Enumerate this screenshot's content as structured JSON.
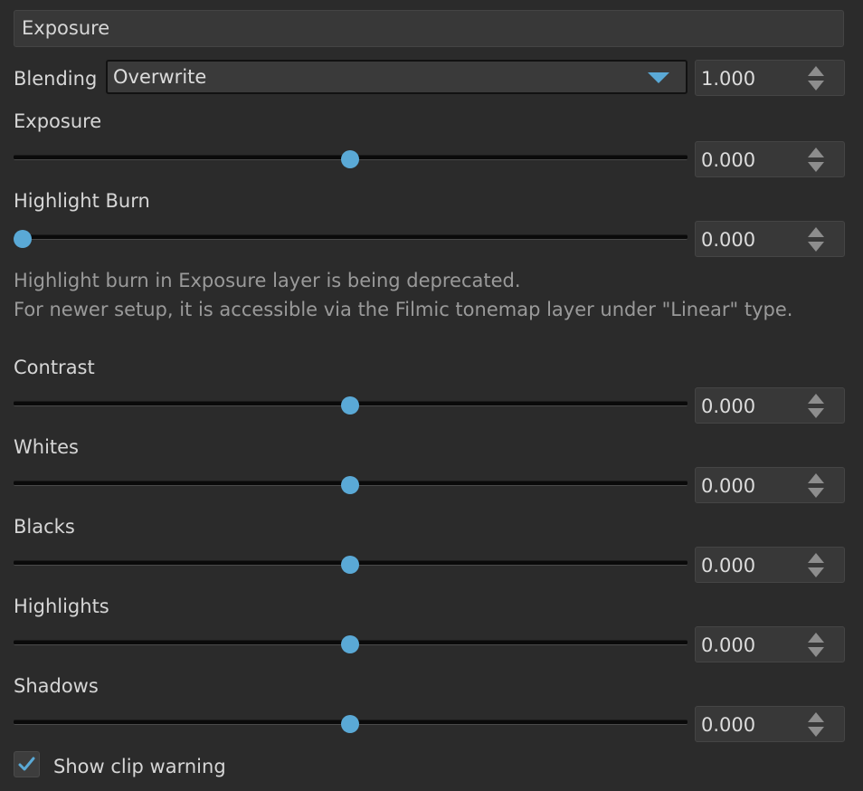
{
  "layer": {
    "name": "Exposure"
  },
  "blending": {
    "label": "Blending",
    "mode": "Overwrite",
    "opacity": "1.000"
  },
  "sliders": [
    {
      "label": "Exposure",
      "value": "0.000",
      "position": 0.5
    },
    {
      "label": "Highlight Burn",
      "value": "0.000",
      "position": 0.0
    },
    {
      "label": "Contrast",
      "value": "0.000",
      "position": 0.5
    },
    {
      "label": "Whites",
      "value": "0.000",
      "position": 0.5
    },
    {
      "label": "Blacks",
      "value": "0.000",
      "position": 0.5
    },
    {
      "label": "Highlights",
      "value": "0.000",
      "position": 0.5
    },
    {
      "label": "Shadows",
      "value": "0.000",
      "position": 0.5
    }
  ],
  "note": {
    "line1": "Highlight burn in Exposure layer is being deprecated.",
    "line2": "For newer setup, it is accessible via the Filmic tonemap layer under \"Linear\" type."
  },
  "clip_warning": {
    "label": "Show clip warning",
    "checked": true
  },
  "colors": {
    "accent": "#5aa9d6",
    "background": "#2b2b2b"
  }
}
